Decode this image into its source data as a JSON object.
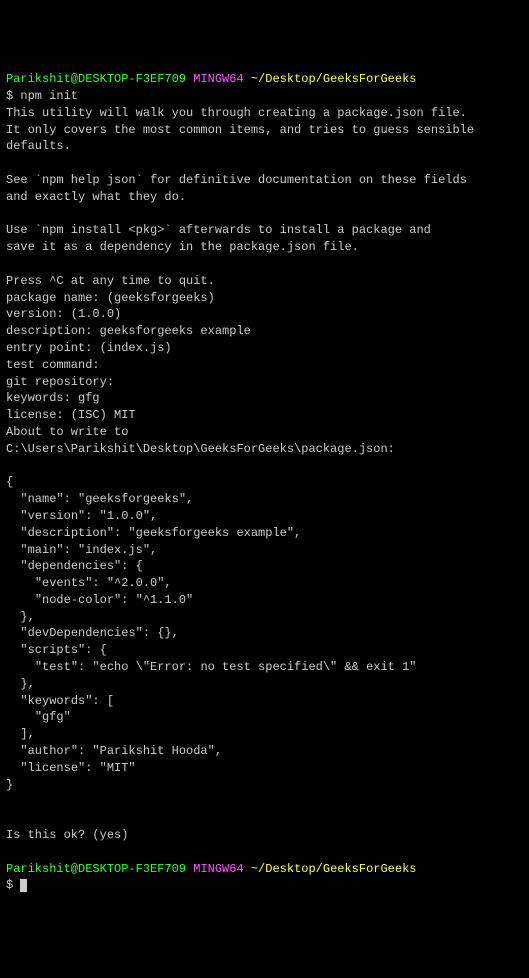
{
  "prompt1": {
    "user": "Parikshit@DESKTOP-F3EF709",
    "shell": "MINGW64",
    "path": "~/Desktop/GeeksForGeeks"
  },
  "cmd1": "$ npm init",
  "intro": "This utility will walk you through creating a package.json file.\nIt only covers the most common items, and tries to guess sensible defaults.\n\nSee `npm help json` for definitive documentation on these fields\nand exactly what they do.\n\nUse `npm install <pkg>` afterwards to install a package and\nsave it as a dependency in the package.json file.\n\nPress ^C at any time to quit.",
  "prompts": {
    "packageName": "package name: (geeksforgeeks)",
    "version": "version: (1.0.0)",
    "description": "description: geeksforgeeks example",
    "entryPoint": "entry point: (index.js)",
    "testCommand": "test command:",
    "gitRepository": "git repository:",
    "keywords": "keywords: gfg",
    "license": "license: (ISC) MIT"
  },
  "aboutToWrite": "About to write to C:\\Users\\Parikshit\\Desktop\\GeeksForGeeks\\package.json:",
  "jsonPreview": "{\n  \"name\": \"geeksforgeeks\",\n  \"version\": \"1.0.0\",\n  \"description\": \"geeksforgeeks example\",\n  \"main\": \"index.js\",\n  \"dependencies\": {\n    \"events\": \"^2.0.0\",\n    \"node-color\": \"^1.1.0\"\n  },\n  \"devDependencies\": {},\n  \"scripts\": {\n    \"test\": \"echo \\\"Error: no test specified\\\" && exit 1\"\n  },\n  \"keywords\": [\n    \"gfg\"\n  ],\n  \"author\": \"Parikshit Hooda\",\n  \"license\": \"MIT\"\n}",
  "confirm": "Is this ok? (yes)",
  "prompt2": {
    "user": "Parikshit@DESKTOP-F3EF709",
    "shell": "MINGW64",
    "path": "~/Desktop/GeeksForGeeks"
  },
  "cmd2": "$ "
}
